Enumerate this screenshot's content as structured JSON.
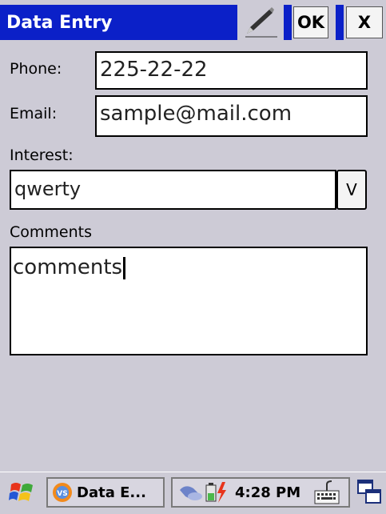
{
  "window": {
    "title": "Data Entry"
  },
  "toolbar": {
    "ok_label": "OK",
    "close_label": "X"
  },
  "form": {
    "phone": {
      "label": "Phone:",
      "value": "225-22-22"
    },
    "email": {
      "label": "Email:",
      "value": "sample@mail.com"
    },
    "interest": {
      "label": "Interest:",
      "value": "qwerty",
      "dropdown_label": "V"
    },
    "comments": {
      "label": "Comments",
      "value": "comments"
    }
  },
  "taskbar": {
    "task_label": "Data E...",
    "clock": "4:28 PM"
  },
  "icons": {
    "pencil": "pencil-icon",
    "start": "windows-flag-icon",
    "app": "app-icon",
    "network": "network-icon",
    "battery": "battery-icon",
    "keyboard": "keyboard-icon",
    "switcher": "window-switch-icon"
  },
  "colors": {
    "title_bar": "#0b20c8",
    "background": "#cdcbd6"
  }
}
